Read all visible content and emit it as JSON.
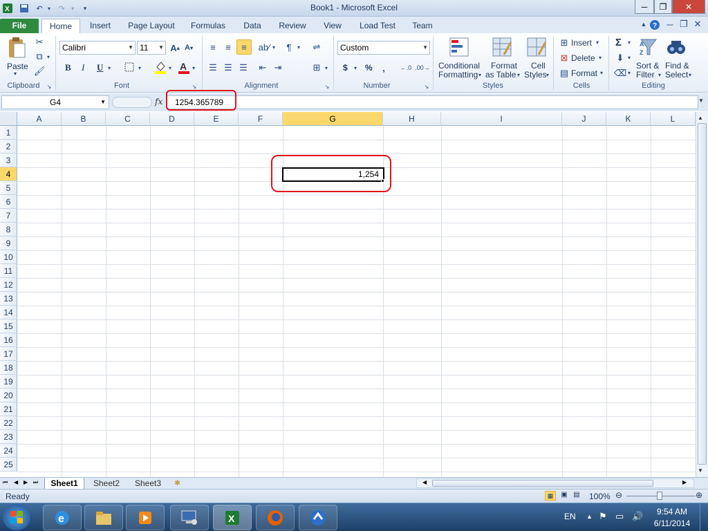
{
  "window": {
    "title": "Book1  -  Microsoft Excel"
  },
  "tabs": [
    {
      "label": "File"
    },
    {
      "label": "Home"
    },
    {
      "label": "Insert"
    },
    {
      "label": "Page Layout"
    },
    {
      "label": "Formulas"
    },
    {
      "label": "Data"
    },
    {
      "label": "Review"
    },
    {
      "label": "View"
    },
    {
      "label": "Load Test"
    },
    {
      "label": "Team"
    }
  ],
  "ribbon": {
    "clipboard": {
      "label": "Clipboard",
      "paste": "Paste"
    },
    "font": {
      "label": "Font",
      "family": "Calibri",
      "size": "11",
      "bold": "B",
      "italic": "I",
      "underline": "U"
    },
    "alignment": {
      "label": "Alignment"
    },
    "number": {
      "label": "Number",
      "format": "Custom",
      "currency": "$",
      "percent": "%"
    },
    "styles": {
      "label": "Styles",
      "conditional_1": "Conditional",
      "conditional_2": "Formatting",
      "format_table_1": "Format",
      "format_table_2": "as Table",
      "cell_styles_1": "Cell",
      "cell_styles_2": "Styles"
    },
    "cells": {
      "label": "Cells",
      "insert": "Insert",
      "delete": "Delete",
      "format": "Format"
    },
    "editing": {
      "label": "Editing",
      "sigma": "Σ",
      "sort_1": "Sort &",
      "sort_2": "Filter",
      "find_1": "Find &",
      "find_2": "Select"
    }
  },
  "formula_bar": {
    "name_box": "G4",
    "fx": "fx",
    "value": "1254.365789"
  },
  "grid": {
    "columns": [
      "A",
      "B",
      "C",
      "D",
      "E",
      "F",
      "G",
      "H",
      "I",
      "J",
      "K",
      "L"
    ],
    "rows": [
      "1",
      "2",
      "3",
      "4",
      "5",
      "6",
      "7",
      "8",
      "9",
      "10",
      "11",
      "12",
      "13",
      "14",
      "15",
      "16",
      "17",
      "18",
      "19",
      "20",
      "21",
      "22",
      "23",
      "24",
      "25"
    ],
    "selected_column": "G",
    "selected_row": "4",
    "active_cell_display": "1,254"
  },
  "sheets": [
    {
      "label": "Sheet1"
    },
    {
      "label": "Sheet2"
    },
    {
      "label": "Sheet3"
    }
  ],
  "status": {
    "mode": "Ready",
    "zoom": "100%"
  },
  "taskbar": {
    "language": "EN",
    "time": "9:54 AM",
    "date": "6/11/2014"
  },
  "colors": {
    "annotation": "#e0141e",
    "file_tab": "#2f8a3f",
    "selected_header": "#fbd86b"
  }
}
